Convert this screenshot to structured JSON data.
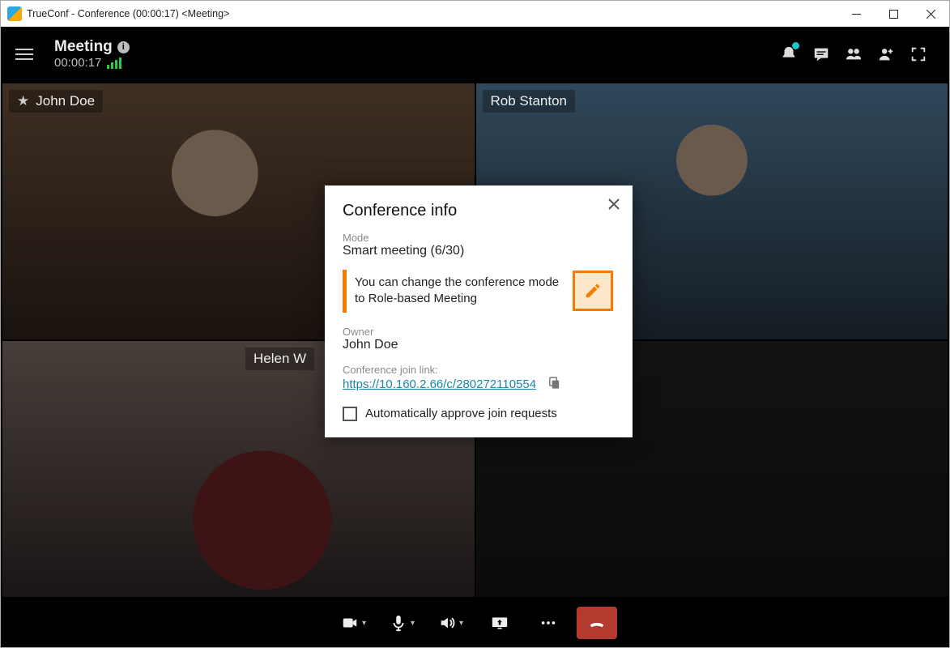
{
  "window": {
    "title": "TrueConf - Conference (00:00:17) <Meeting>"
  },
  "appbar": {
    "meeting_label": "Meeting",
    "timer": "00:00:17"
  },
  "participants": {
    "p1": "John Doe",
    "p2": "Rob Stanton",
    "p3": "Helen W"
  },
  "dialog": {
    "title": "Conference info",
    "mode_label": "Mode",
    "mode_value": "Smart meeting (6/30)",
    "hint_text": "You can change the conference mode to Role-based Meeting",
    "owner_label": "Owner",
    "owner_value": "John Doe",
    "link_label": "Conference join link:",
    "link_value": "https://10.160.2.66/c/280272110554",
    "auto_approve_label": "Automatically approve join requests"
  }
}
